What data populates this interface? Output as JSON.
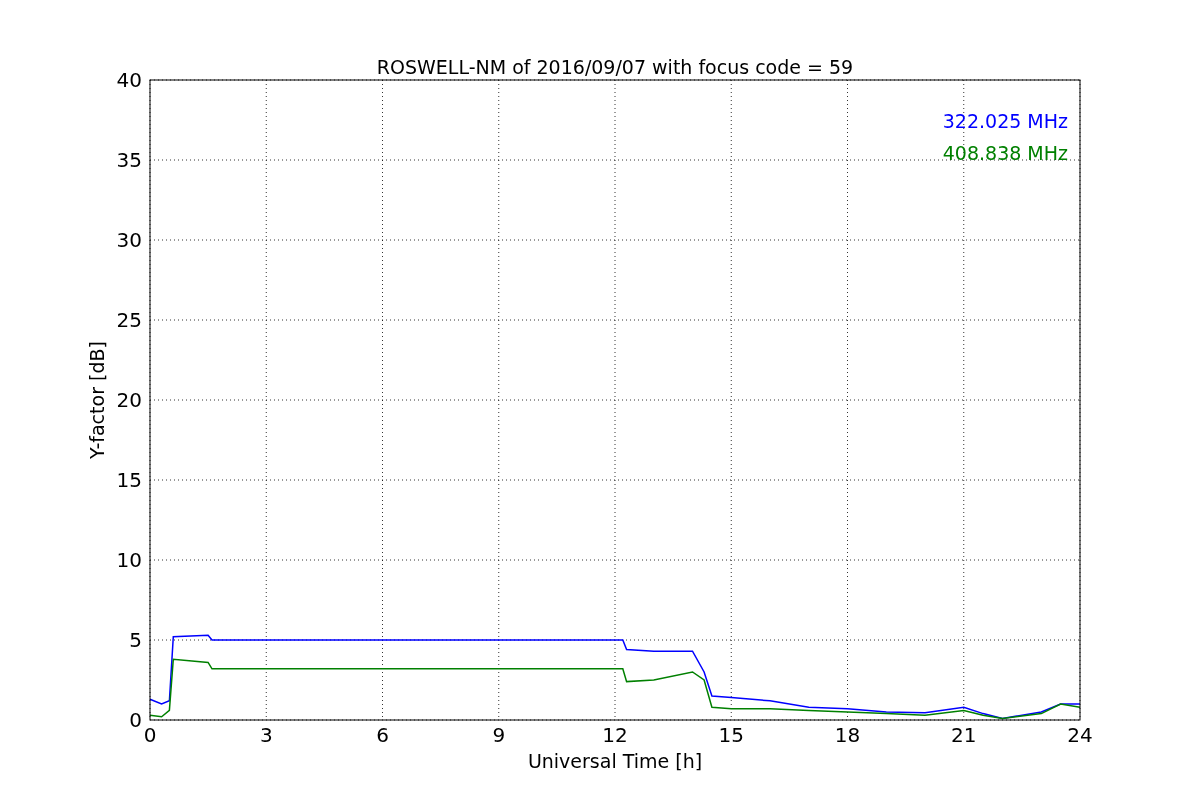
{
  "chart_data": {
    "type": "line",
    "title": "ROSWELL-NM of 2016/09/07 with focus code = 59",
    "xlabel": "Universal Time [h]",
    "ylabel": "Y-factor [dB]",
    "x": [
      0,
      0.3,
      0.5,
      0.6,
      1.5,
      1.6,
      12.2,
      12.3,
      13,
      14,
      14.3,
      14.5,
      15,
      16,
      17,
      18,
      19,
      20,
      21,
      21.5,
      22,
      23,
      23.5,
      24
    ],
    "series": [
      {
        "name": "322.025 MHz",
        "color": "#0000ff",
        "values": [
          1.3,
          1.0,
          1.2,
          5.2,
          5.3,
          5.0,
          5.0,
          4.4,
          4.3,
          4.3,
          3.0,
          1.5,
          1.4,
          1.2,
          0.8,
          0.7,
          0.5,
          0.45,
          0.8,
          0.4,
          0.1,
          0.5,
          1.0,
          1.0
        ]
      },
      {
        "name": "408.838 MHz",
        "color": "#008000",
        "values": [
          0.3,
          0.2,
          0.6,
          3.8,
          3.6,
          3.2,
          3.2,
          2.4,
          2.5,
          3.0,
          2.5,
          0.8,
          0.7,
          0.7,
          0.6,
          0.5,
          0.4,
          0.3,
          0.6,
          0.3,
          0.1,
          0.4,
          1.0,
          0.8
        ]
      }
    ],
    "xlim": [
      0,
      24
    ],
    "ylim": [
      0,
      40
    ],
    "xticks": [
      0,
      3,
      6,
      9,
      12,
      15,
      18,
      21,
      24
    ],
    "yticks": [
      0,
      5,
      10,
      15,
      20,
      25,
      30,
      35,
      40
    ],
    "grid": true
  }
}
